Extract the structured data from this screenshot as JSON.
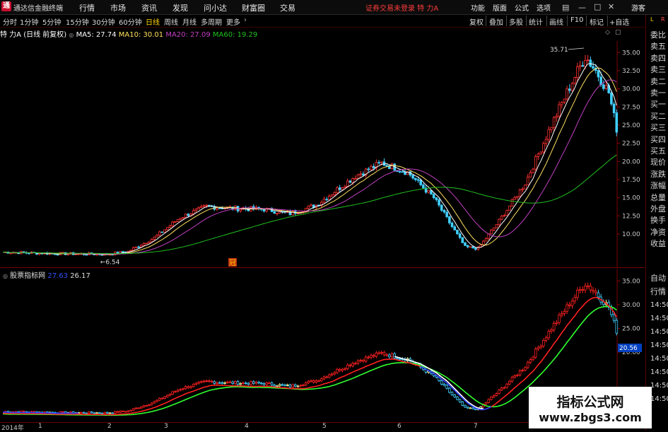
{
  "app": {
    "title": "通达信金融终端",
    "logo_glyph": "通"
  },
  "menu": [
    "行情",
    "市场",
    "资讯",
    "发现",
    "问小达",
    "财富圈",
    "交易"
  ],
  "alert": "证券交易未登录 特 力A",
  "right_menu": [
    "功能",
    "版面",
    "公式",
    "选项",
    "游客"
  ],
  "periods": [
    "分时",
    "1分钟",
    "5分钟",
    "15分钟",
    "30分钟",
    "60分钟",
    "日线",
    "周线",
    "月线",
    "多周期",
    "更多"
  ],
  "active_period": "日线",
  "tools": [
    "复权",
    "叠加",
    "多股",
    "统计",
    "画线",
    "F10",
    "标记",
    "+自选"
  ],
  "info": {
    "stock": "特 力A",
    "mode": "(日线 前复权)",
    "ma5": "MA5: 27.74",
    "ma10": "MA10: 30.01",
    "ma20": "MA20: 27.09",
    "ma60": "MA60: 19.29"
  },
  "sub_info": {
    "name": "股票指标网",
    "v1": "27.63",
    "v2": "26.17"
  },
  "right_panel_labels": [
    "委比",
    "卖五",
    "卖四",
    "卖三",
    "卖二",
    "卖一",
    "买一",
    "买二",
    "买三",
    "买四",
    "买五",
    "现价",
    "涨跌",
    "涨幅",
    "总量",
    "外盘",
    "换手",
    "净资",
    "收益"
  ],
  "right_panel_sub": [
    "自动",
    "行情",
    "14:50",
    "14:50",
    "14:50",
    "14:50",
    "14:50",
    "14:50",
    "14:50",
    "14:50"
  ],
  "top_right_marks": [
    "L",
    "R"
  ],
  "price_axis": [
    "35.00",
    "32.50",
    "30.00",
    "27.50",
    "25.00",
    "22.50",
    "20.00",
    "17.50",
    "15.00",
    "12.50",
    "10.00"
  ],
  "sub_axis": [
    "35.00",
    "30.00",
    "25.00",
    "20.00"
  ],
  "sub_price_tag": "20.56",
  "annotations": {
    "high": "35.71",
    "low": "6.54",
    "marker": "冠"
  },
  "x_axis": [
    "2014年",
    "1",
    "2",
    "3",
    "4",
    "5",
    "6",
    "7"
  ],
  "watermark": {
    "line1": "指标公式网",
    "line2": "www.zbgs3.com"
  },
  "colors": {
    "up": "#ff3030",
    "down": "#40d0ff",
    "ma5": "#ffffff",
    "ma10": "#ffe060",
    "ma20": "#c040c0",
    "ma60": "#20c020",
    "accent": "#ffd400"
  },
  "chart_data": {
    "type": "line",
    "title": "",
    "x": [
      "2014年",
      "1",
      "2",
      "3",
      "4",
      "5",
      "6",
      "7"
    ],
    "ylim": [
      6,
      36
    ],
    "annotations": [
      {
        "label": "35.71",
        "value": 35.71
      },
      {
        "label": "6.54",
        "value": 6.54
      }
    ],
    "series": [
      {
        "name": "MA5",
        "values": [
          7.5,
          7.3,
          7.2,
          8.8,
          11.5,
          13.6,
          13.4,
          12.8,
          14.8,
          19.5,
          18.5,
          8.2,
          12.0,
          20.5,
          29.8,
          34.0,
          27.74
        ]
      },
      {
        "name": "MA10",
        "values": [
          7.6,
          7.4,
          7.2,
          8.4,
          11.0,
          13.2,
          13.5,
          13.0,
          14.4,
          19.0,
          18.8,
          9.5,
          11.0,
          19.0,
          28.0,
          33.0,
          30.01
        ]
      },
      {
        "name": "MA20",
        "values": [
          7.8,
          7.5,
          7.3,
          8.0,
          10.2,
          12.6,
          13.3,
          13.1,
          13.8,
          17.5,
          18.8,
          11.5,
          10.8,
          16.0,
          24.0,
          30.0,
          27.09
        ]
      },
      {
        "name": "MA60",
        "values": [
          8.3,
          7.9,
          7.6,
          7.6,
          8.5,
          10.0,
          11.2,
          12.2,
          13.0,
          14.0,
          15.8,
          15.5,
          15.0,
          15.5,
          16.8,
          18.2,
          19.29
        ]
      }
    ]
  }
}
